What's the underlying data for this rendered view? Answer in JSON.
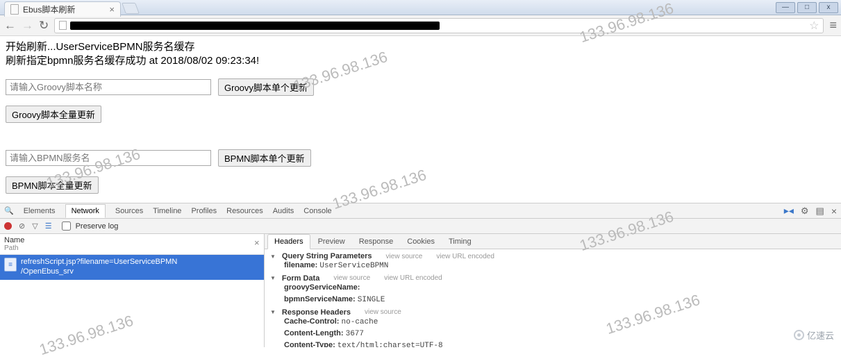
{
  "browser": {
    "tab_title": "Ebus脚本刷新",
    "window_buttons": {
      "min": "—",
      "max": "□",
      "close": "x"
    }
  },
  "nav": {
    "back": "←",
    "forward": "→",
    "reload": "↻",
    "menu": "≡"
  },
  "page": {
    "line1": "开始刷新...UserServiceBPMN服务名缓存",
    "line2": "刷新指定bpmn服务名缓存成功 at 2018/08/02 09:23:34!",
    "groovy_input_placeholder": "请输入Groovy脚本名称",
    "groovy_single_btn": "Groovy脚本单个更新",
    "groovy_all_btn": "Groovy脚本全量更新",
    "bpmn_input_placeholder": "请输入BPMN服务名",
    "bpmn_single_btn": "BPMN脚本单个更新",
    "bpmn_all_btn": "BPMN脚本全量更新"
  },
  "devtools": {
    "tabs": {
      "elements": "Elements",
      "network": "Network",
      "sources": "Sources",
      "timeline": "Timeline",
      "profiles": "Profiles",
      "resources": "Resources",
      "audits": "Audits",
      "console": "Console"
    },
    "preserve_log": "Preserve log",
    "left": {
      "name": "Name",
      "path": "Path",
      "req_line1": "refreshScript.jsp?filename=UserServiceBPMN",
      "req_line2": "/OpenEbus_srv"
    },
    "detail_tabs": {
      "headers": "Headers",
      "preview": "Preview",
      "response": "Response",
      "cookies": "Cookies",
      "timing": "Timing"
    },
    "details": {
      "qsp_title": "Query String Parameters",
      "view_source": "view source",
      "view_url_encoded": "view URL encoded",
      "qsp_k1": "filename:",
      "qsp_v1": "UserServiceBPMN",
      "form_title": "Form Data",
      "form_k1": "groovyServiceName:",
      "form_v1": "",
      "form_k2": "bpmnServiceName:",
      "form_v2": "SINGLE",
      "resp_title": "Response Headers",
      "resp_k1": "Cache-Control:",
      "resp_v1": "no-cache",
      "resp_k2": "Content-Length:",
      "resp_v2": "3677",
      "resp_k3": "Content-Type:",
      "resp_v3": "text/html;charset=UTF-8"
    }
  },
  "watermark": "133.96.98.136",
  "brand": "亿速云"
}
